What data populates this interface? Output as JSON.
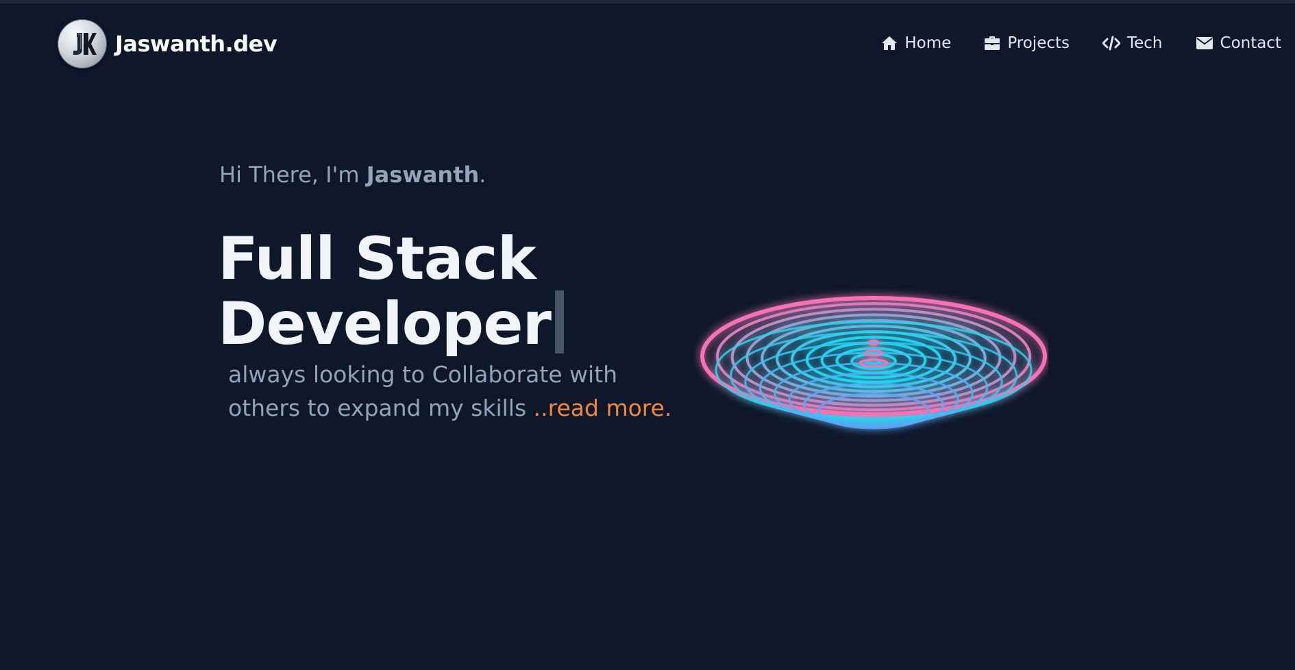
{
  "header": {
    "brand_name": "Jaswanth.dev",
    "logo_icon": "jk-monogram-logo",
    "nav": [
      {
        "label": "Home",
        "icon": "home-icon"
      },
      {
        "label": "Projects",
        "icon": "briefcase-icon"
      },
      {
        "label": "Tech",
        "icon": "code-icon"
      },
      {
        "label": "Contact",
        "icon": "envelope-icon"
      }
    ]
  },
  "hero": {
    "greeting_prefix": "Hi There, I'm ",
    "greeting_name": "Jaswanth",
    "greeting_suffix": ".",
    "headline_line1": "Full Stack",
    "headline_line2": "Developer",
    "tagline": "always looking to Collaborate with others to expand my skills ",
    "read_more": "..read more."
  },
  "colors": {
    "background": "#0f172a",
    "accent_orange": "#f0883e",
    "muted_text": "#94a3b8",
    "ring_pink": "#f472b6",
    "ring_cyan": "#22d3ee"
  }
}
